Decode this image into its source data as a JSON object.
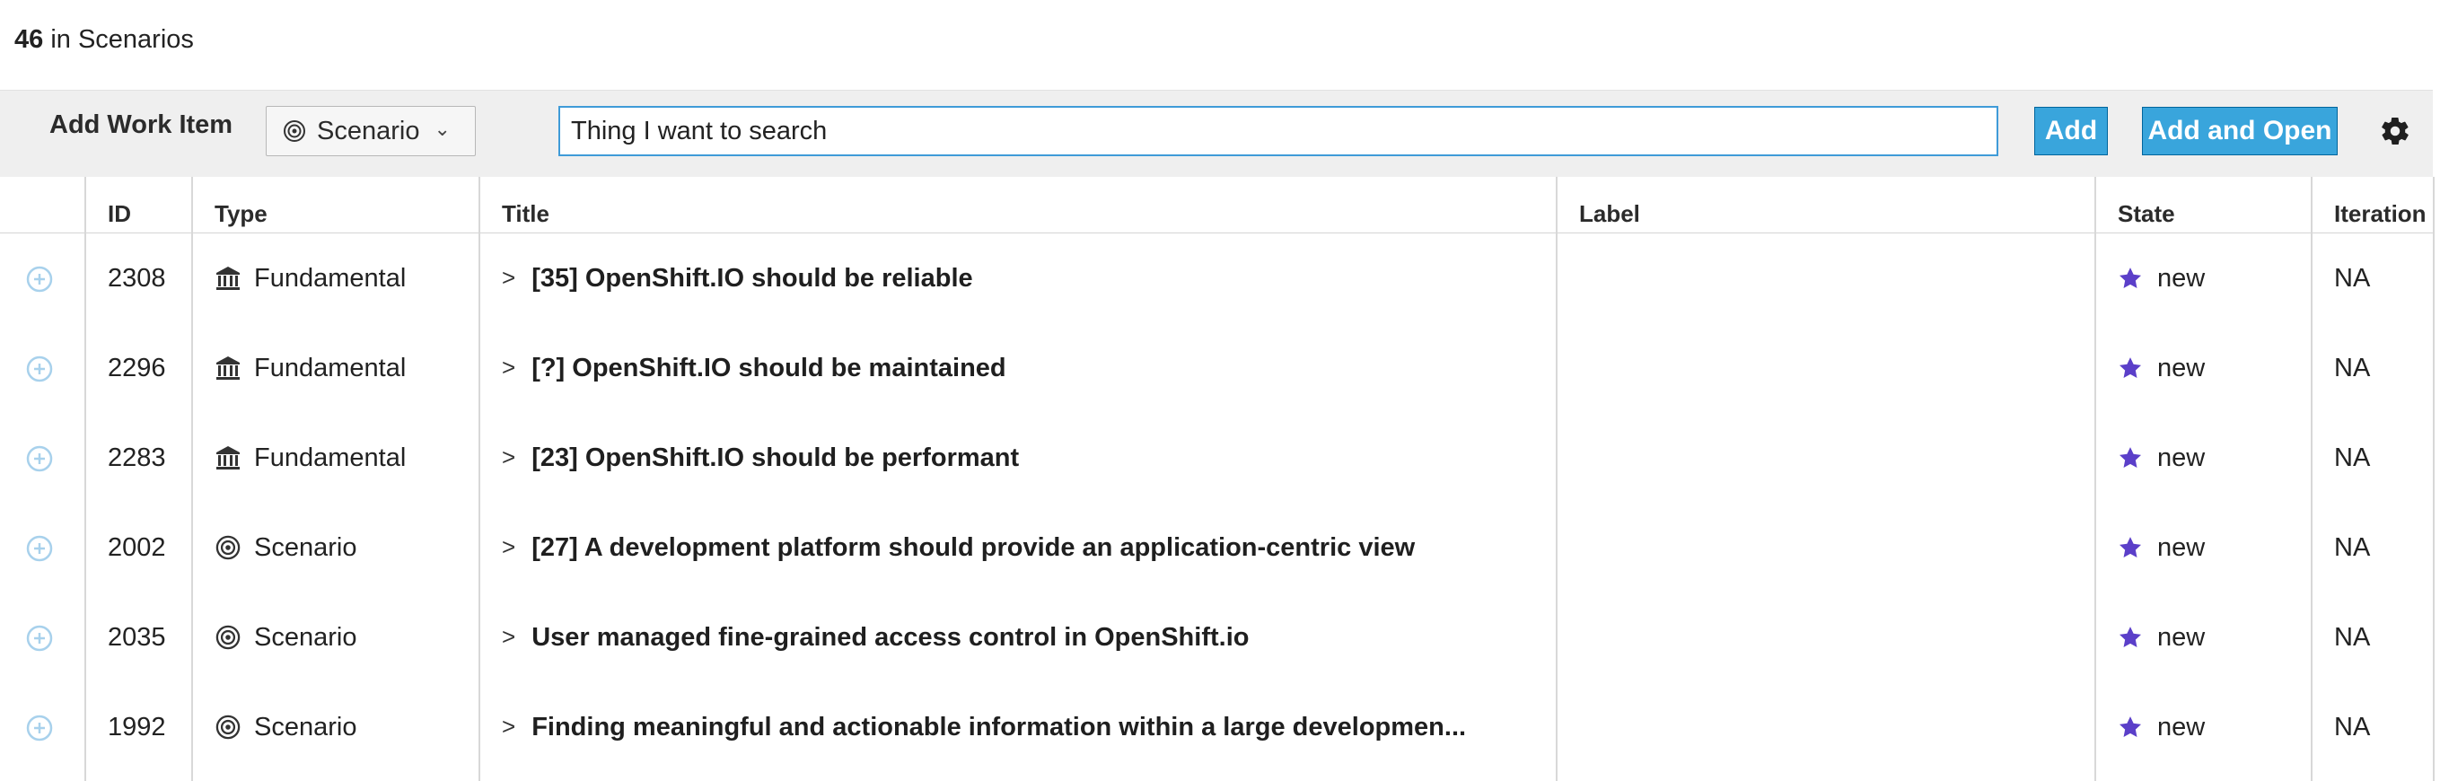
{
  "summary": {
    "count": "46",
    "text": "in Scenarios"
  },
  "add_bar": {
    "label": "Add Work Item",
    "type_select": {
      "value": "Scenario",
      "icon": "scenario-target-icon"
    },
    "search_value": "Thing I want to search",
    "add_label": "Add",
    "add_open_label": "Add and Open",
    "settings_icon": "gear-icon"
  },
  "columns": [
    "ID",
    "Type",
    "Title",
    "Label",
    "State",
    "Iteration"
  ],
  "colors": {
    "accent": "#39a5dc",
    "state_star": "#5b3fc9",
    "plus_icon": "#a8d1ec"
  },
  "rows": [
    {
      "id": "2308",
      "type": "Fundamental",
      "type_icon": "fundamental-building-icon",
      "title": "[35] OpenShift.IO should be reliable",
      "label": "",
      "state": "new",
      "iteration": "NA"
    },
    {
      "id": "2296",
      "type": "Fundamental",
      "type_icon": "fundamental-building-icon",
      "title": "[?] OpenShift.IO should be maintained",
      "label": "",
      "state": "new",
      "iteration": "NA"
    },
    {
      "id": "2283",
      "type": "Fundamental",
      "type_icon": "fundamental-building-icon",
      "title": "[23] OpenShift.IO should be performant",
      "label": "",
      "state": "new",
      "iteration": "NA"
    },
    {
      "id": "2002",
      "type": "Scenario",
      "type_icon": "scenario-target-icon",
      "title": "[27] A development platform should provide an application-centric view",
      "label": "",
      "state": "new",
      "iteration": "NA"
    },
    {
      "id": "2035",
      "type": "Scenario",
      "type_icon": "scenario-target-icon",
      "title": "User managed fine-grained access control in OpenShift.io",
      "label": "",
      "state": "new",
      "iteration": "NA"
    },
    {
      "id": "1992",
      "type": "Scenario",
      "type_icon": "scenario-target-icon",
      "title": "Finding meaningful and actionable information within a large developmen...",
      "label": "",
      "state": "new",
      "iteration": "NA"
    }
  ]
}
